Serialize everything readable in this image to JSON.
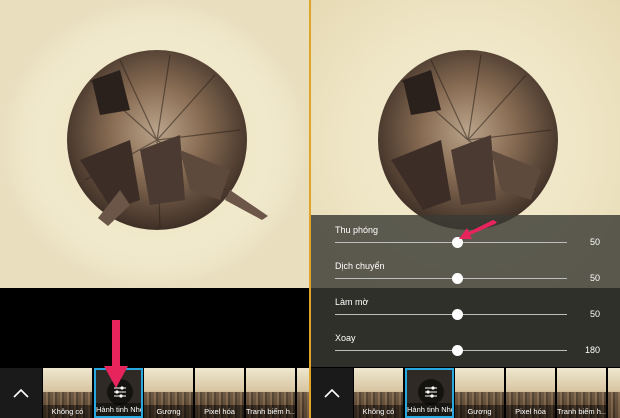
{
  "filters": [
    {
      "label": "Không có"
    },
    {
      "label": "Hành tinh Nhỏ",
      "selected": true
    },
    {
      "label": "Gương"
    },
    {
      "label": "Pixel hóa"
    },
    {
      "label": "Tranh biếm h..."
    }
  ],
  "adjustments": [
    {
      "label": "Thu phóng",
      "value": "50",
      "level": 0.5
    },
    {
      "label": "Dịch chuyển",
      "value": "50",
      "level": 0.5
    },
    {
      "label": "Làm mờ",
      "value": "50",
      "level": 0.5
    },
    {
      "label": "Xoay",
      "value": "180",
      "level": 0.5
    }
  ],
  "colors": {
    "accent": "#29a8e0",
    "annotation": "#e8245c",
    "divider": "#e0a528"
  },
  "icons": {
    "collapse": "chevron-up-icon",
    "adjust": "sliders-icon",
    "annotation": "arrow-icon"
  }
}
